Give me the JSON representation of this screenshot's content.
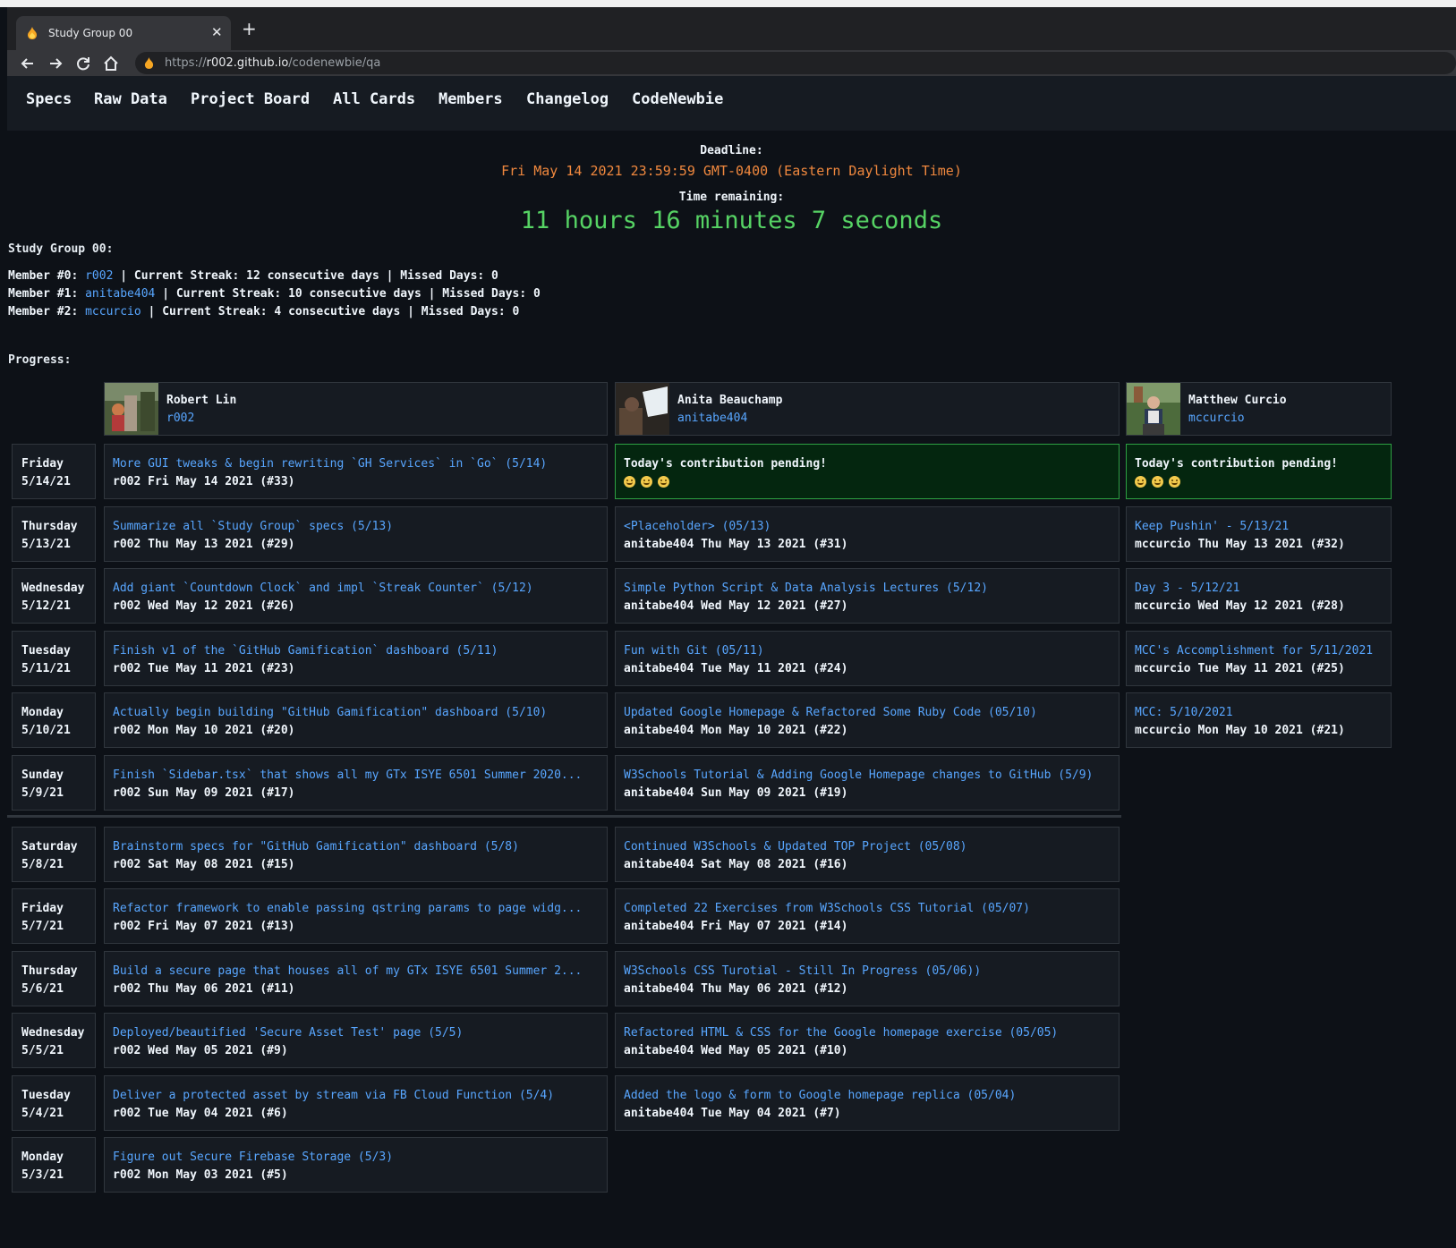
{
  "browser": {
    "tab_title": "Study Group 00",
    "url_prefix": "https://",
    "url_domain": "r002.github.io",
    "url_path": "/codenewbie/qa",
    "favicon": "flame-icon"
  },
  "nav": {
    "items": [
      "Specs",
      "Raw Data",
      "Project Board",
      "All Cards",
      "Members",
      "Changelog",
      "CodeNewbie"
    ]
  },
  "deadline": {
    "label": "Deadline:",
    "value": "Fri May 14 2021 23:59:59 GMT-0400 (Eastern Daylight Time)",
    "remaining_label": "Time remaining:",
    "remaining": "11 hours 16 minutes 7 seconds"
  },
  "study_group": {
    "title": "Study Group 00:",
    "members": [
      {
        "prefix": "Member #0: ",
        "handle": "r002",
        "suffix": " | Current Streak: 12 consecutive days | Missed Days: 0"
      },
      {
        "prefix": "Member #1: ",
        "handle": "anitabe404",
        "suffix": " | Current Streak: 10 consecutive days | Missed Days: 0"
      },
      {
        "prefix": "Member #2: ",
        "handle": "mccurcio",
        "suffix": " | Current Streak: 4 consecutive days | Missed Days: 0"
      }
    ]
  },
  "progress": {
    "title": "Progress:",
    "people": [
      {
        "name": "Robert Lin",
        "handle": "r002"
      },
      {
        "name": "Anita Beauchamp",
        "handle": "anitabe404"
      },
      {
        "name": "Matthew Curcio",
        "handle": "mccurcio"
      }
    ],
    "pending_text": "Today's contribution pending!",
    "rows": [
      {
        "day": "Friday",
        "date": "5/14/21",
        "cells": [
          {
            "title": "More GUI tweaks & begin rewriting `GH Services` in `Go` (5/14)",
            "meta": "r002 Fri May 14 2021 (#33)"
          },
          {
            "pending": true
          },
          {
            "pending": true
          }
        ]
      },
      {
        "day": "Thursday",
        "date": "5/13/21",
        "cells": [
          {
            "title": "Summarize all `Study Group` specs (5/13)",
            "meta": "r002 Thu May 13 2021 (#29)"
          },
          {
            "title": "<Placeholder> (05/13)",
            "meta": "anitabe404 Thu May 13 2021 (#31)"
          },
          {
            "title": "Keep Pushin' - 5/13/21",
            "meta": "mccurcio Thu May 13 2021 (#32)"
          }
        ]
      },
      {
        "day": "Wednesday",
        "date": "5/12/21",
        "cells": [
          {
            "title": "Add giant `Countdown Clock` and impl `Streak Counter` (5/12)",
            "meta": "r002 Wed May 12 2021 (#26)"
          },
          {
            "title": "Simple Python Script & Data Analysis Lectures (5/12)",
            "meta": "anitabe404 Wed May 12 2021 (#27)"
          },
          {
            "title": "Day 3 - 5/12/21",
            "meta": "mccurcio Wed May 12 2021 (#28)"
          }
        ]
      },
      {
        "day": "Tuesday",
        "date": "5/11/21",
        "cells": [
          {
            "title": "Finish v1 of the `GitHub Gamification` dashboard (5/11)",
            "meta": "r002 Tue May 11 2021 (#23)"
          },
          {
            "title": "Fun with Git (05/11)",
            "meta": "anitabe404 Tue May 11 2021 (#24)"
          },
          {
            "title": "MCC's Accomplishment for 5/11/2021",
            "meta": "mccurcio Tue May 11 2021 (#25)"
          }
        ]
      },
      {
        "day": "Monday",
        "date": "5/10/21",
        "cells": [
          {
            "title": "Actually begin building \"GitHub Gamification\" dashboard (5/10)",
            "meta": "r002 Mon May 10 2021 (#20)"
          },
          {
            "title": "Updated Google Homepage & Refactored Some Ruby Code (05/10)",
            "meta": "anitabe404 Mon May 10 2021 (#22)"
          },
          {
            "title": "MCC: 5/10/2021",
            "meta": "mccurcio Mon May 10 2021 (#21)"
          }
        ]
      },
      {
        "day": "Sunday",
        "date": "5/9/21",
        "cells": [
          {
            "title": "Finish `Sidebar.tsx` that shows all my GTx ISYE 6501 Summer 2020...",
            "meta": "r002 Sun May 09 2021 (#17)"
          },
          {
            "title": "W3Schools Tutorial & Adding Google Homepage changes to GitHub (5/9)",
            "meta": "anitabe404 Sun May 09 2021 (#19)"
          }
        ]
      },
      {
        "day": "Saturday",
        "date": "5/8/21",
        "cells": [
          {
            "title": "Brainstorm specs for \"GitHub Gamification\" dashboard (5/8)",
            "meta": "r002 Sat May 08 2021 (#15)"
          },
          {
            "title": "Continued W3Schools & Updated TOP Project (05/08)",
            "meta": "anitabe404 Sat May 08 2021 (#16)"
          }
        ]
      },
      {
        "day": "Friday",
        "date": "5/7/21",
        "cells": [
          {
            "title": "Refactor framework to enable passing qstring params to page widg...",
            "meta": "r002 Fri May 07 2021 (#13)"
          },
          {
            "title": "Completed 22 Exercises from W3Schools CSS Tutorial (05/07)",
            "meta": "anitabe404 Fri May 07 2021 (#14)"
          }
        ]
      },
      {
        "day": "Thursday",
        "date": "5/6/21",
        "cells": [
          {
            "title": "Build a secure page that houses all of my GTx ISYE 6501 Summer 2...",
            "meta": "r002 Thu May 06 2021 (#11)"
          },
          {
            "title": "W3Schools CSS Turotial - Still In Progress (05/06))",
            "meta": "anitabe404 Thu May 06 2021 (#12)"
          }
        ]
      },
      {
        "day": "Wednesday",
        "date": "5/5/21",
        "cells": [
          {
            "title": "Deployed/beautified 'Secure Asset Test' page (5/5)",
            "meta": "r002 Wed May 05 2021 (#9)"
          },
          {
            "title": "Refactored HTML & CSS for the Google homepage exercise (05/05)",
            "meta": "anitabe404 Wed May 05 2021 (#10)"
          }
        ]
      },
      {
        "day": "Tuesday",
        "date": "5/4/21",
        "cells": [
          {
            "title": "Deliver a protected asset by stream via FB Cloud Function (5/4)",
            "meta": "r002 Tue May 04 2021 (#6)"
          },
          {
            "title": "Added the logo & form to Google homepage replica (05/04)",
            "meta": "anitabe404 Tue May 04 2021 (#7)"
          }
        ]
      },
      {
        "day": "Monday",
        "date": "5/3/21",
        "cells": [
          {
            "title": "Figure out Secure Firebase Storage (5/3)",
            "meta": "r002 Mon May 03 2021 (#5)"
          }
        ]
      }
    ]
  },
  "colors": {
    "link": "#58a6ff",
    "deadline": "#f0883e",
    "countdown": "#56d364",
    "pending_bg": "#04260f"
  }
}
